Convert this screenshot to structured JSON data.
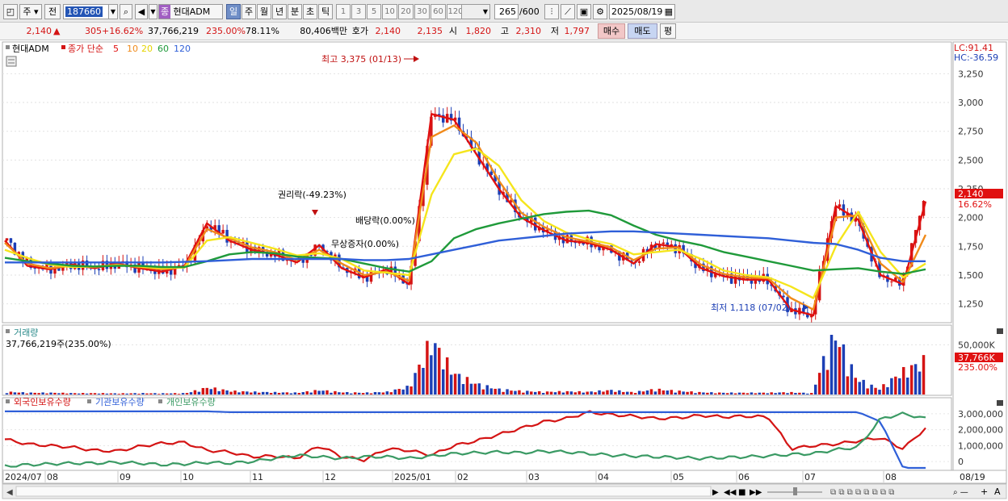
{
  "toolbar": {
    "period_select": "주",
    "view_select": "전",
    "code_value": "187660",
    "stock_badge": "종",
    "stock_name": "현대ADM",
    "periods": [
      "일",
      "주",
      "월",
      "년",
      "분",
      "초",
      "틱"
    ],
    "active_period": "일",
    "intervals": [
      "1",
      "3",
      "5",
      "10",
      "20",
      "30",
      "60",
      "120"
    ],
    "count_value": "265",
    "count_total": "/600",
    "date_value": "2025/08/19"
  },
  "quote": {
    "price": "2,140",
    "change_arrow": "▲",
    "change": "305",
    "change_pct": "+16.62%",
    "volume": "37,766,219",
    "volume_ratio": "235.00%",
    "turnover": "78.11%",
    "amount": "80,406백만",
    "open_label": "호가",
    "ask": "2,140",
    "bid": "2,135",
    "open_label2": "시",
    "open": "1,820",
    "high_label": "고",
    "high": "2,310",
    "low_label": "저",
    "low": "1,797",
    "buy_label": "매수",
    "sell_label": "매도",
    "avg_label": "평"
  },
  "price_panel": {
    "title": "현대ADM",
    "ma_label": "종가 단순",
    "ma_periods": [
      "5",
      "10",
      "20",
      "60",
      "120"
    ],
    "lc_label": "LC:91.41",
    "hc_label": "HC:-36.59",
    "last_price_tag": "2,140",
    "last_pct_tag": "16.62%",
    "annotations": {
      "high": "최고 3,375 (01/13)",
      "low": "최저 1,118 (07/02)",
      "rights": "권리락(-49.23%)",
      "dividend": "배당락(0.00%)",
      "bonus": "무상증자(0.00%)"
    }
  },
  "volume_panel": {
    "title": "거래량",
    "value_text": "37,766,219주(235.00%)",
    "axis_label": "50,000K",
    "last_tag": "37,766K",
    "last_pct_tag": "235.00%"
  },
  "holdings_panel": {
    "legend": [
      "외국인보유수량",
      "기관보유수량",
      "개인보유수량"
    ],
    "axis_labels": [
      "3,000,000",
      "2,000,000",
      "1,000,000",
      "0"
    ]
  },
  "time_axis": {
    "labels": [
      "2024/07",
      "08",
      "09",
      "10",
      "11",
      "12",
      "2025/01",
      "02",
      "03",
      "04",
      "05",
      "06",
      "07",
      "08",
      "08/19"
    ]
  },
  "colors": {
    "up": "#d41414",
    "down": "#1c3fb5",
    "ma5": "#e01010",
    "ma10": "#f08a1a",
    "ma20": "#f5e51c",
    "ma60": "#1f9a3a",
    "ma120": "#2f5fd8",
    "foreign": "#d41414",
    "institution": "#2f5fd8",
    "individual": "#3a9a64"
  },
  "chart_data": [
    {
      "type": "line",
      "title": "현대ADM",
      "series": [
        {
          "name": "5",
          "values": [
            1800,
            1580,
            1550,
            1590,
            1560,
            1600,
            1560,
            1530,
            1580,
            1950,
            1800,
            1720,
            1680,
            1610,
            1760,
            1560,
            1480,
            1550,
            1420,
            2900,
            2850,
            2550,
            2250,
            2000,
            1890,
            1800,
            1780,
            1720,
            1600,
            1770,
            1740,
            1560,
            1490,
            1460,
            1460,
            1200,
            1150,
            2100,
            1980,
            1500,
            1420,
            2140
          ]
        },
        {
          "name": "10",
          "values": [
            1780,
            1600,
            1560,
            1580,
            1570,
            1590,
            1570,
            1550,
            1570,
            1900,
            1820,
            1740,
            1700,
            1630,
            1720,
            1600,
            1500,
            1530,
            1450,
            2700,
            2800,
            2650,
            2320,
            2040,
            1920,
            1830,
            1790,
            1740,
            1630,
            1730,
            1740,
            1590,
            1510,
            1480,
            1470,
            1300,
            1200,
            2000,
            2020,
            1600,
            1440,
            1850
          ]
        },
        {
          "name": "20",
          "values": [
            1720,
            1650,
            1590,
            1570,
            1575,
            1585,
            1575,
            1560,
            1565,
            1800,
            1830,
            1780,
            1730,
            1670,
            1690,
            1640,
            1540,
            1520,
            1500,
            2200,
            2550,
            2600,
            2450,
            2150,
            1970,
            1870,
            1810,
            1770,
            1680,
            1700,
            1720,
            1640,
            1540,
            1500,
            1480,
            1400,
            1300,
            1750,
            2050,
            1700,
            1480,
            1600
          ]
        },
        {
          "name": "60",
          "values": [
            1650,
            1620,
            1600,
            1580,
            1575,
            1580,
            1580,
            1570,
            1570,
            1620,
            1680,
            1700,
            1690,
            1660,
            1650,
            1640,
            1600,
            1560,
            1530,
            1620,
            1820,
            1900,
            1950,
            1990,
            2030,
            2050,
            2060,
            2020,
            1930,
            1850,
            1800,
            1760,
            1700,
            1660,
            1620,
            1580,
            1540,
            1550,
            1560,
            1530,
            1510,
            1550
          ]
        },
        {
          "name": "120",
          "values": [
            1610,
            1610,
            1610,
            1610,
            1610,
            1610,
            1610,
            1610,
            1615,
            1620,
            1630,
            1640,
            1640,
            1640,
            1640,
            1640,
            1630,
            1630,
            1640,
            1680,
            1720,
            1760,
            1800,
            1820,
            1840,
            1860,
            1870,
            1880,
            1880,
            1870,
            1860,
            1850,
            1840,
            1830,
            1820,
            1800,
            1780,
            1770,
            1720,
            1650,
            1620,
            1620
          ]
        }
      ],
      "ylim": [
        1100,
        3400
      ],
      "yticks": [
        1250,
        1500,
        1750,
        2000,
        2250,
        2500,
        2750,
        3000,
        3250
      ]
    },
    {
      "type": "bar",
      "title": "거래량",
      "ylim": [
        0,
        60000
      ],
      "ylabel": "50,000K",
      "values": [
        3000,
        2000,
        2000,
        1500,
        1500,
        1200,
        1500,
        1300,
        1500,
        8000,
        4000,
        3000,
        2500,
        2000,
        5000,
        2500,
        2000,
        3000,
        9000,
        62000,
        24000,
        12000,
        6000,
        4000,
        3000,
        3500,
        3000,
        5000,
        2500,
        6000,
        4000,
        2500,
        2000,
        2000,
        2000,
        2500,
        1500,
        72000,
        18000,
        6000,
        25000,
        37766
      ]
    },
    {
      "type": "line",
      "title": "외국인보유수량 기관보유수량 개인보유수량",
      "ylim": [
        -500000,
        3500000
      ],
      "yticks": [
        0,
        1000000,
        2000000,
        3000000
      ],
      "series": [
        {
          "name": "외국인보유수량",
          "values": [
            1400000,
            1100000,
            1000000,
            900000,
            700000,
            650000,
            950000,
            1150000,
            1200000,
            700000,
            600000,
            300000,
            350000,
            200000,
            1000000,
            300000,
            100000,
            800000,
            700000,
            400000,
            1000000,
            1300000,
            1700000,
            2100000,
            2500000,
            2700000,
            3100000,
            2950000,
            2850000,
            2700000,
            2750000,
            2900000,
            2800000,
            2850000,
            2800000,
            800000,
            1000000,
            1100000,
            1300000,
            1500000,
            800000,
            2100000
          ]
        },
        {
          "name": "기관보유수량",
          "values": [
            3150000,
            3150000,
            3150000,
            3150000,
            3150000,
            3150000,
            3150000,
            3150000,
            3150000,
            3150000,
            3100000,
            3100000,
            3100000,
            3100000,
            3100000,
            3100000,
            3100000,
            3100000,
            3100000,
            3100000,
            3100000,
            3100000,
            3100000,
            3100000,
            3100000,
            3100000,
            3100000,
            3100000,
            3100000,
            3100000,
            3100000,
            3100000,
            3100000,
            3100000,
            3100000,
            3100000,
            3100000,
            3100000,
            3100000,
            2500000,
            -400000,
            -400000
          ]
        },
        {
          "name": "개인보유수량",
          "values": [
            -300000,
            -200000,
            -150000,
            -100000,
            -100000,
            -50000,
            -100000,
            -200000,
            -150000,
            -50000,
            -100000,
            0,
            200000,
            400000,
            300000,
            200000,
            300000,
            300000,
            200000,
            350000,
            500000,
            550000,
            600000,
            550000,
            650000,
            600000,
            500000,
            400000,
            350000,
            300000,
            250000,
            200000,
            250000,
            300000,
            350000,
            450000,
            500000,
            750000,
            900000,
            2700000,
            3000000,
            2700000
          ]
        }
      ]
    }
  ]
}
